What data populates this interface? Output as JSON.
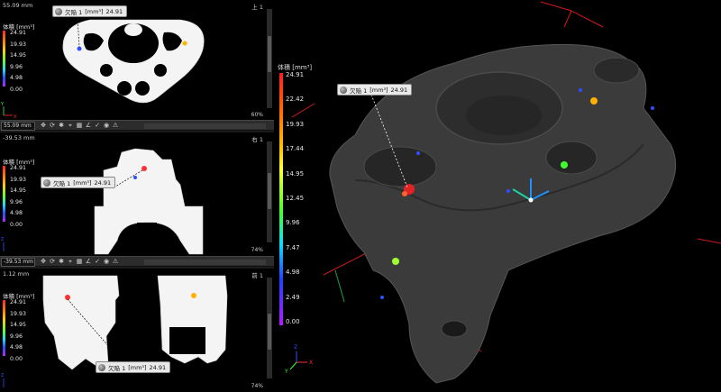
{
  "views": {
    "top": {
      "coord": "55.09 mm",
      "name": "上 1",
      "zoom": "60%",
      "toolbar_coord": "55.09 mm"
    },
    "middle": {
      "coord": "-39.53 mm",
      "name": "右 1",
      "zoom": "74%",
      "toolbar_coord": "-39.53 mm"
    },
    "bottom": {
      "coord": "1.12 mm",
      "name": "前 1",
      "zoom": "74%"
    }
  },
  "legend": {
    "title": "体積 [mm³]",
    "mini_ticks": [
      "24.91",
      "19.93",
      "14.95",
      "9.96",
      "4.98",
      "0.00"
    ],
    "big_ticks": [
      "24.91",
      "22.42",
      "19.93",
      "17.44",
      "14.95",
      "12.45",
      "9.96",
      "7.47",
      "4.98",
      "2.49",
      "0.00"
    ],
    "colors": {
      "max": "#ff2020",
      "mid": "#45ff2a",
      "min": "#b21cff"
    }
  },
  "defect": {
    "label": "欠陥 1",
    "unit": "[mm³]",
    "value": "24.91"
  },
  "axes": {
    "x": "X",
    "y": "Y",
    "z": "Z"
  },
  "icons": {
    "zoom_tools": [
      "zoom-in-icon",
      "zoom-out-icon",
      "fit-icon",
      "reset-icon"
    ],
    "toolbar": [
      "pan-icon",
      "rotate-icon",
      "snap-icon",
      "measure-icon",
      "grid-icon",
      "angle-icon",
      "angle-2-icon",
      "check-icon",
      "check-2-icon",
      "color-icon",
      "warning-icon",
      "arrow-icon"
    ]
  }
}
